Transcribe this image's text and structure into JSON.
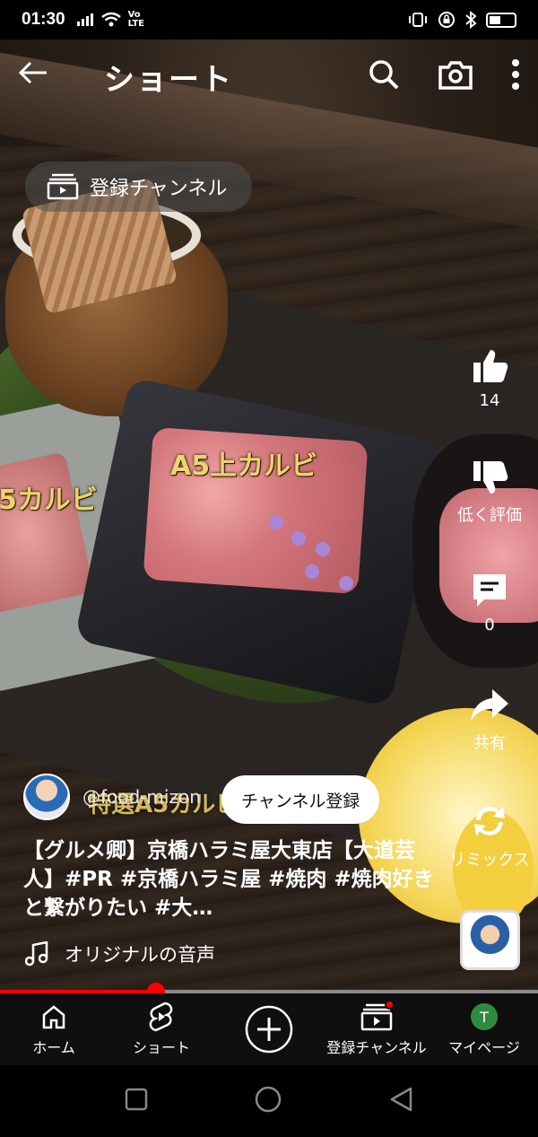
{
  "status_bar": {
    "time": "01:30",
    "network_label": "Vo LTE"
  },
  "header": {
    "title": "ショート"
  },
  "subscriptions_pill": {
    "label": "登録チャンネル"
  },
  "video_overlay": {
    "label_center": "A5上カルビ",
    "label_left": "5カルビ",
    "label_bottom": "特選A5カルビ ・ 上カルビ"
  },
  "actions": {
    "like_count": "14",
    "dislike_label": "低く評価",
    "comment_count": "0",
    "share_label": "共有",
    "remix_label": "リミックス"
  },
  "channel": {
    "handle": "@food-mizon",
    "subscribe_label": "チャンネル登録"
  },
  "caption": {
    "text": "【グルメ卿】京橋ハラミ屋大東店【大道芸人】#PR #京橋ハラミ屋 #焼肉 #焼肉好きと繋がりたい #大…"
  },
  "sound": {
    "label": "オリジナルの音声"
  },
  "progress": {
    "fraction": 0.29
  },
  "bottom_nav": {
    "home": "ホーム",
    "shorts": "ショート",
    "subscriptions": "登録チャンネル",
    "me": "マイページ",
    "me_initial": "T"
  },
  "colors": {
    "accent": "#ff0000",
    "nav_bg": "#0f0f0f",
    "avatar_green": "#2e8b3e"
  }
}
